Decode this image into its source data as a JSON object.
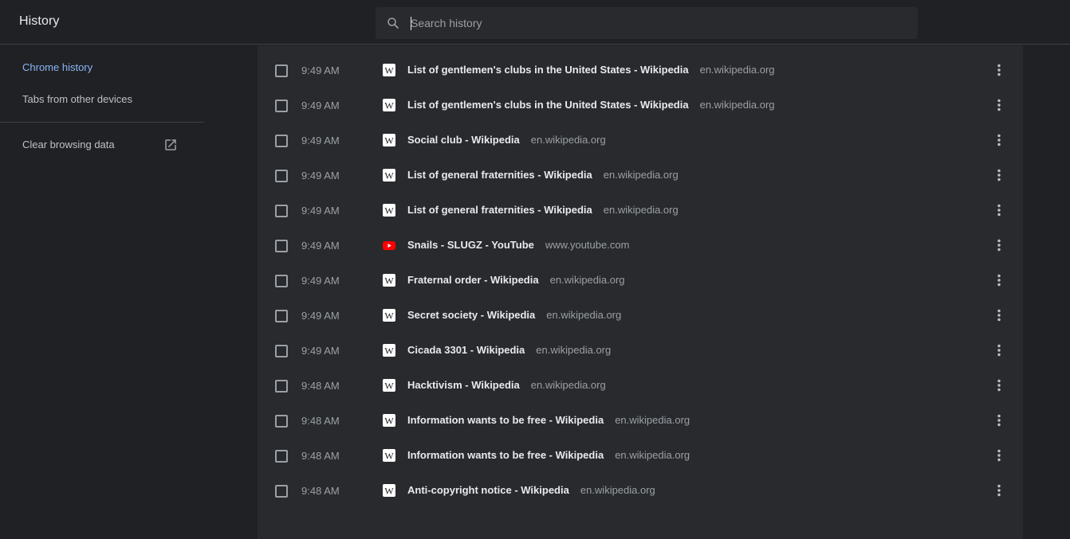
{
  "header": {
    "title": "History"
  },
  "search": {
    "placeholder": "Search history"
  },
  "sidebar": {
    "items": [
      {
        "label": "Chrome history",
        "active": true
      },
      {
        "label": "Tabs from other devices",
        "active": false
      }
    ],
    "clear_label": "Clear browsing data"
  },
  "colors": {
    "accent": "#8ab4f8",
    "background": "#202124",
    "card": "#292a2d",
    "youtube": "#ff0000"
  },
  "entries": [
    {
      "time": "9:49 AM",
      "title": "List of gentlemen's clubs in the United States - Wikipedia",
      "domain": "en.wikipedia.org",
      "favicon": "wikipedia-icon"
    },
    {
      "time": "9:49 AM",
      "title": "List of gentlemen's clubs in the United States - Wikipedia",
      "domain": "en.wikipedia.org",
      "favicon": "wikipedia-icon"
    },
    {
      "time": "9:49 AM",
      "title": "Social club - Wikipedia",
      "domain": "en.wikipedia.org",
      "favicon": "wikipedia-icon"
    },
    {
      "time": "9:49 AM",
      "title": "List of general fraternities - Wikipedia",
      "domain": "en.wikipedia.org",
      "favicon": "wikipedia-icon"
    },
    {
      "time": "9:49 AM",
      "title": "List of general fraternities - Wikipedia",
      "domain": "en.wikipedia.org",
      "favicon": "wikipedia-icon"
    },
    {
      "time": "9:49 AM",
      "title": "Snails - SLUGZ - YouTube",
      "domain": "www.youtube.com",
      "favicon": "youtube-icon"
    },
    {
      "time": "9:49 AM",
      "title": "Fraternal order - Wikipedia",
      "domain": "en.wikipedia.org",
      "favicon": "wikipedia-icon"
    },
    {
      "time": "9:49 AM",
      "title": "Secret society - Wikipedia",
      "domain": "en.wikipedia.org",
      "favicon": "wikipedia-icon"
    },
    {
      "time": "9:49 AM",
      "title": "Cicada 3301 - Wikipedia",
      "domain": "en.wikipedia.org",
      "favicon": "wikipedia-icon"
    },
    {
      "time": "9:48 AM",
      "title": "Hacktivism - Wikipedia",
      "domain": "en.wikipedia.org",
      "favicon": "wikipedia-icon"
    },
    {
      "time": "9:48 AM",
      "title": "Information wants to be free - Wikipedia",
      "domain": "en.wikipedia.org",
      "favicon": "wikipedia-icon"
    },
    {
      "time": "9:48 AM",
      "title": "Information wants to be free - Wikipedia",
      "domain": "en.wikipedia.org",
      "favicon": "wikipedia-icon"
    },
    {
      "time": "9:48 AM",
      "title": "Anti-copyright notice - Wikipedia",
      "domain": "en.wikipedia.org",
      "favicon": "wikipedia-icon"
    }
  ]
}
